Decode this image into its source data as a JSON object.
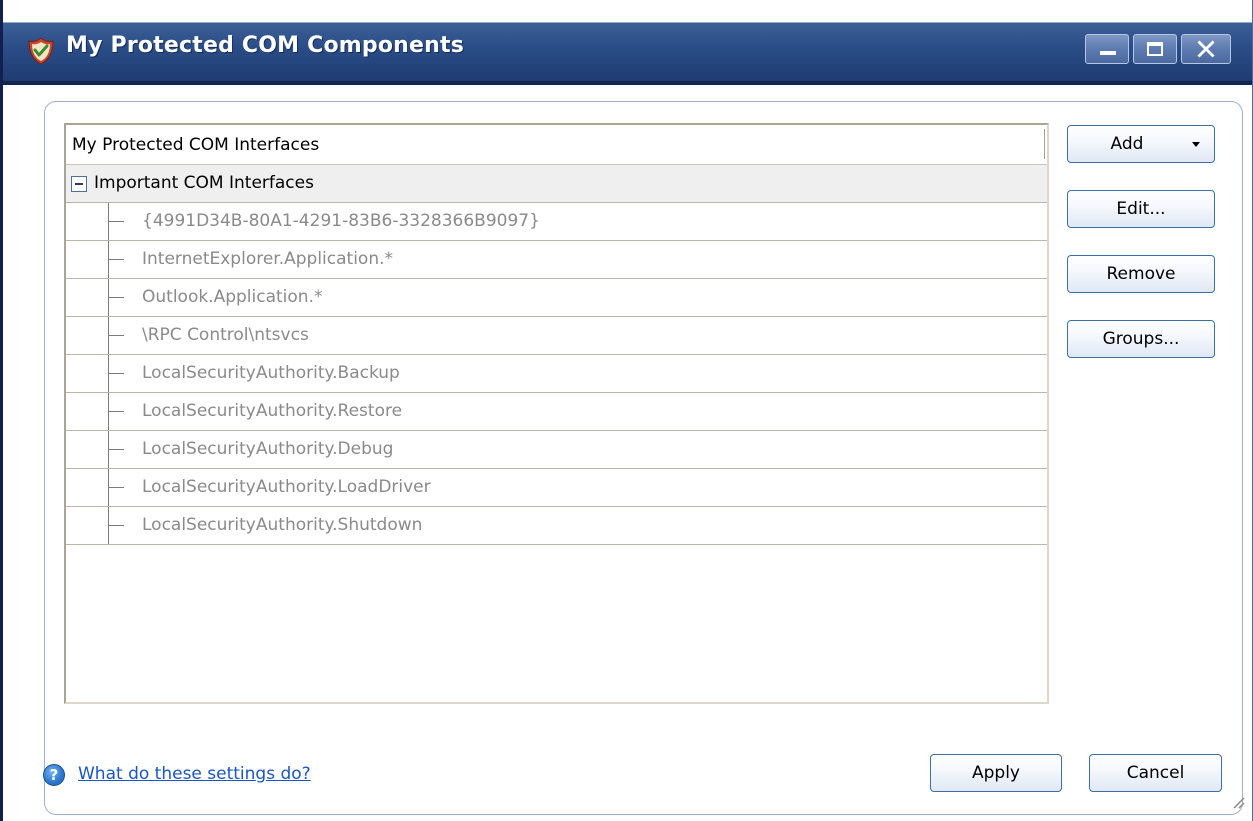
{
  "window": {
    "title": "My Protected COM Components",
    "controls": [
      "minimize-icon",
      "maximize-icon",
      "close-icon"
    ]
  },
  "tree": {
    "header": "My Protected COM Interfaces",
    "group": {
      "label": "Important COM Interfaces",
      "expanded": true,
      "children": [
        "{4991D34B-80A1-4291-83B6-3328366B9097}",
        "InternetExplorer.Application.*",
        "Outlook.Application.*",
        "\\RPC Control\\ntsvcs",
        "LocalSecurityAuthority.Backup",
        "LocalSecurityAuthority.Restore",
        "LocalSecurityAuthority.Debug",
        "LocalSecurityAuthority.LoadDriver",
        "LocalSecurityAuthority.Shutdown"
      ]
    }
  },
  "buttons": {
    "add": "Add",
    "edit": "Edit...",
    "remove": "Remove",
    "groups": "Groups...",
    "apply": "Apply",
    "cancel": "Cancel"
  },
  "help": {
    "icon": "help-icon",
    "link_text": "What do these settings do?"
  },
  "colors": {
    "title_bar": "#2a4c86",
    "button_border": "#3c6fa8",
    "link": "#1a55c4",
    "disabled_text": "#8a8a8a"
  }
}
